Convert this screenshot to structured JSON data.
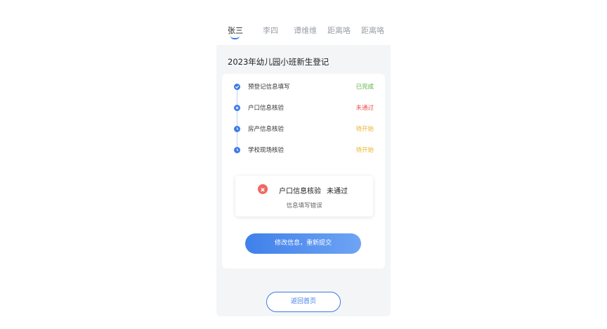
{
  "tabs": [
    {
      "label": "张三",
      "active": true
    },
    {
      "label": "李四",
      "active": false
    },
    {
      "label": "谭维维",
      "active": false
    },
    {
      "label": "距离咯",
      "active": false
    },
    {
      "label": "距离咯",
      "active": false
    }
  ],
  "page_title": "2023年幼儿园小班新生登记",
  "steps": [
    {
      "label": "预登记信息填写",
      "status": "已完成",
      "status_color": "#5ab13f",
      "icon": "check-icon"
    },
    {
      "label": "户口信息核验",
      "status": "未通过",
      "status_color": "#e8524a",
      "icon": "close-icon"
    },
    {
      "label": "房产信息核验",
      "status": "待开始",
      "status_color": "#e6b62f",
      "icon": "clock-icon"
    },
    {
      "label": "学校现场核验",
      "status": "待开始",
      "status_color": "#e6b62f",
      "icon": "clock-icon"
    }
  ],
  "result": {
    "title": "户口信息核验",
    "status": "未通过",
    "description": "信息填写错误",
    "icon": "error-circle-icon",
    "icon_color": "#ee6a62"
  },
  "primary_button": {
    "label": "修改信息，重新提交"
  },
  "home_button": {
    "label": "返回首页"
  },
  "colors": {
    "accent": "#3d7be6",
    "background": "#f4f5f7",
    "card": "#ffffff"
  }
}
